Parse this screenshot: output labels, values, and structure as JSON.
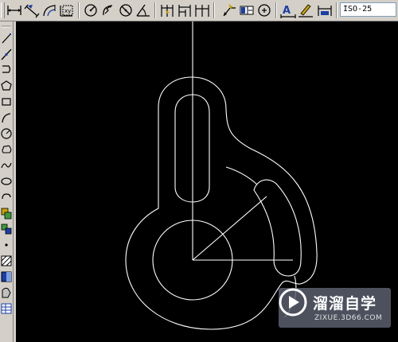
{
  "toolbar": {
    "groups": [
      [
        "linear-dimension",
        "aligned-dimension",
        "arc-length-dimension",
        "ordinate-dimension"
      ],
      [
        "radius-dimension",
        "jogged-dimension",
        "diameter-dimension",
        "angular-dimension"
      ],
      [
        "quick-dimension",
        "baseline-dimension",
        "continue-dimension"
      ],
      [
        "quick-leader",
        "tolerance",
        "center-mark"
      ],
      [
        "dimension-edit",
        "dimension-text-edit",
        "dimension-update"
      ]
    ],
    "dimension_style": "ISO-25"
  },
  "left_toolbar": {
    "tools": [
      "line",
      "construction-line",
      "polyline",
      "polygon",
      "rectangle",
      "arc",
      "circle",
      "revision-cloud",
      "spline",
      "ellipse",
      "ellipse-arc",
      "insert-block",
      "make-block",
      "point",
      "hatch",
      "gradient",
      "region",
      "table"
    ]
  },
  "canvas": {
    "background": "#000000",
    "line_color": "#ffffff"
  },
  "watermark": {
    "title": "溜溜自学",
    "url": "ZIXUE.3D66.COM"
  }
}
